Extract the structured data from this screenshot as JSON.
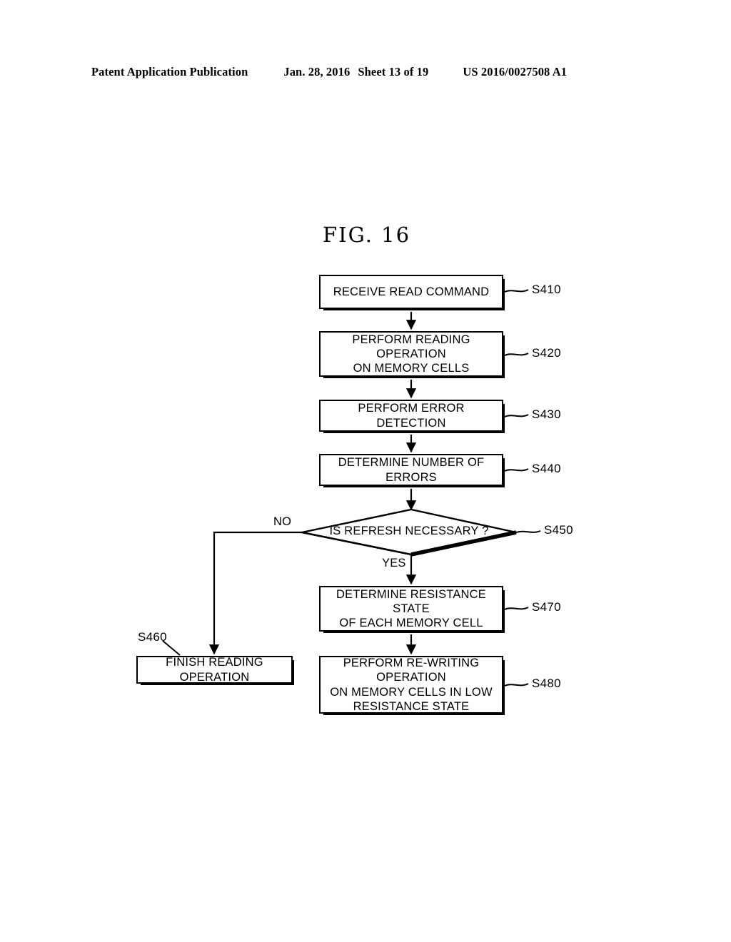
{
  "header": {
    "publication": "Patent Application Publication",
    "date": "Jan. 28, 2016",
    "sheet": "Sheet 13 of 19",
    "patent_number": "US 2016/0027508 A1"
  },
  "figure": {
    "title": "FIG.  16"
  },
  "flowchart": {
    "nodes": [
      {
        "id": "S410",
        "shape": "process",
        "text": "RECEIVE READ COMMAND",
        "ref": "S410"
      },
      {
        "id": "S420",
        "shape": "process",
        "text": "PERFORM READING OPERATION\nON MEMORY CELLS",
        "ref": "S420"
      },
      {
        "id": "S430",
        "shape": "process",
        "text": "PERFORM ERROR DETECTION",
        "ref": "S430"
      },
      {
        "id": "S440",
        "shape": "process",
        "text": "DETERMINE NUMBER OF ERRORS",
        "ref": "S440"
      },
      {
        "id": "S450",
        "shape": "decision",
        "text": "IS REFRESH NECESSARY ?",
        "ref": "S450"
      },
      {
        "id": "S460",
        "shape": "process",
        "text": "FINISH READING OPERATION",
        "ref": "S460"
      },
      {
        "id": "S470",
        "shape": "process",
        "text": "DETERMINE RESISTANCE STATE\nOF EACH MEMORY CELL",
        "ref": "S470"
      },
      {
        "id": "S480",
        "shape": "process",
        "text": "PERFORM RE-WRITING OPERATION\nON MEMORY CELLS IN LOW\nRESISTANCE STATE",
        "ref": "S480"
      }
    ],
    "branches": {
      "no": "NO",
      "yes": "YES"
    },
    "edges": [
      {
        "from": "S410",
        "to": "S420",
        "label": ""
      },
      {
        "from": "S420",
        "to": "S430",
        "label": ""
      },
      {
        "from": "S430",
        "to": "S440",
        "label": ""
      },
      {
        "from": "S440",
        "to": "S450",
        "label": ""
      },
      {
        "from": "S450",
        "to": "S460",
        "label": "NO"
      },
      {
        "from": "S450",
        "to": "S470",
        "label": "YES"
      },
      {
        "from": "S470",
        "to": "S480",
        "label": ""
      }
    ]
  },
  "colors": {
    "ink": "#000000",
    "paper": "#ffffff"
  }
}
